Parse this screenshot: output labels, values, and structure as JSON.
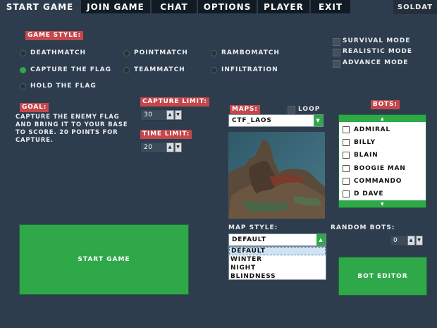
{
  "tabs": [
    {
      "label": "Start Game",
      "active": true
    },
    {
      "label": "Join Game",
      "active": false
    },
    {
      "label": "Chat",
      "active": false
    },
    {
      "label": "Options",
      "active": false
    },
    {
      "label": "Player",
      "active": false
    },
    {
      "label": "Exit",
      "active": false
    }
  ],
  "brand": "Soldat",
  "game_style": {
    "label": "Game Style:",
    "modes": [
      {
        "label": "Deathmatch",
        "selected": false
      },
      {
        "label": "Pointmatch",
        "selected": false
      },
      {
        "label": "Rambomatch",
        "selected": false
      },
      {
        "label": "Capture the Flag",
        "selected": true
      },
      {
        "label": "Teammatch",
        "selected": false
      },
      {
        "label": "Infiltration",
        "selected": false
      },
      {
        "label": "Hold the Flag",
        "selected": false
      }
    ]
  },
  "options": [
    {
      "label": "Survival Mode",
      "checked": false
    },
    {
      "label": "Realistic Mode",
      "checked": false
    },
    {
      "label": "Advance Mode",
      "checked": false
    }
  ],
  "goal": {
    "label": "Goal:",
    "text": "Capture the enemy flag and bring it to your base to score. 20 points for capture."
  },
  "capture_limit": {
    "label": "Capture Limit:",
    "value": "30"
  },
  "time_limit": {
    "label": "Time Limit:",
    "value": "20"
  },
  "maps": {
    "label": "Maps:",
    "loop_label": "Loop",
    "loop_checked": false,
    "selected": "ctf_Laos"
  },
  "map_style": {
    "label": "Map Style:",
    "selected": "Default",
    "options": [
      "Default",
      "Winter",
      "Night",
      "Blindness"
    ]
  },
  "bots": {
    "label": "Bots:",
    "items": [
      "Admiral",
      "Billy",
      "Blain",
      "Boogie Man",
      "Commando",
      "D Dave"
    ]
  },
  "random_bots": {
    "label": "Random Bots:",
    "value": "0"
  },
  "buttons": {
    "start_game": "Start Game",
    "bot_editor": "Bot Editor"
  },
  "colors": {
    "accent_green": "#2fa84a",
    "label_red": "#c4474b",
    "background": "#2e3d4e",
    "tab_dark": "#111b24"
  }
}
